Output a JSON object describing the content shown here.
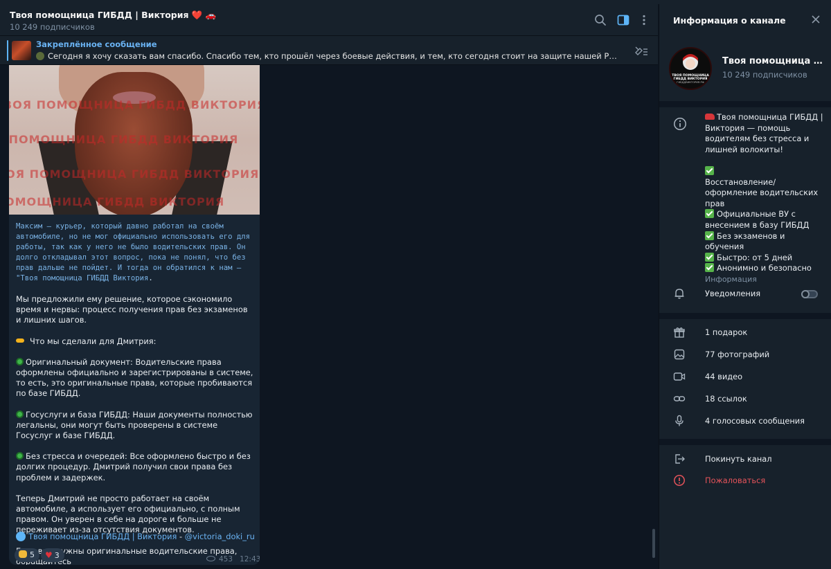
{
  "chat": {
    "title": "Твоя помощница ГИБДД | Виктория ❤️ 🚗",
    "subscribers": "10 249 подписчиков"
  },
  "pinned": {
    "label": "Закреплённое сообщение",
    "text": "Сегодня я хочу сказать вам спасибо. Спасибо тем, кто прошёл через боевые действия, и тем, кто сегодня стоит на защите нашей Родины.  Я — просто Викт..."
  },
  "message": {
    "watermark": "ТВОЯ ПОМОЩНИЦА ГИБДД ВИКТОРИЯ",
    "mono_text": "Максим – курьер, который давно работал на своём автомобиле, но не мог официально использовать его для работы, так как у него не было водительских прав. Он долго откладывал этот вопрос, пока не понял, что без прав дальше не пойдет. И тогда он обратился к нам – \"Твоя помощница ГИБДД Виктория",
    "mono_end": ".",
    "p1": "Мы предложили ему решение, которое сэкономило время и нервы: процесс получения прав без экзаменов и лишних шагов.",
    "p2": "Что мы сделали для Дмитрия:",
    "p3": "Оригинальный документ: Водительские права оформлены официально и зарегистрированы в системе, то есть, это оригинальные права, которые пробиваются по базе ГИБДД.",
    "p4": "Госуслуги и база ГИБДД: Наши документы полностью легальны, они могут быть проверены в системе Госуслуг и базе ГИБДД.",
    "p5": "Без стресса и очередей: Все оформлено быстро и без долгих процедур. Дмитрий получил свои права без проблем и задержек.",
    "p6": "Теперь Дмитрий не просто работает на своём автомобиле, а использует его официально, с полным правом. Он уверен в себе на дороге и больше не переживает из-за отсутствия документов.",
    "p7": "Если вам нужны оригинальные водительские права, обращайтесь",
    "signature_name": "Твоя помощница ГИБДД | Виктория",
    "signature_sep": " - ",
    "signature_handle": "@victoria_doki_ru",
    "reaction_clap": "5",
    "reaction_heart": "3",
    "views": "453",
    "time": "12:43"
  },
  "side": {
    "title": "Информация о канале",
    "channel_name": "Твоя помощница ГИБДД | Виктория",
    "subscribers": "10 249 подписчиков",
    "avatar_text1": "ТВОЯ ПОМОЩНИЦА",
    "avatar_text2": "ГИБДД ВИКТОРИЯ",
    "avatar_text3": "ГИБДДВИКТОРИЯ.РФ",
    "desc_intro": "Твоя помощница ГИБДД | Виктория — помощь водителям без стресса и лишней волокиты!",
    "desc_items": [
      "Восстановление/оформление водительских прав",
      "Официальные ВУ с внесением в базу ГИБДД",
      "Без экзаменов и обучения",
      "Быстро: от 5 дней",
      "Анонимно и безопасно"
    ],
    "desc_label": "Информация",
    "notifications": "Уведомления",
    "media": {
      "gifts": "1 подарок",
      "photos": "77 фотографий",
      "videos": "44 видео",
      "links": "18 ссылок",
      "voice": "4 голосовых сообщения"
    },
    "leave": "Покинуть канал",
    "report": "Пожаловаться"
  },
  "colors": {
    "accent": "#6ab3f3",
    "danger": "#e5535a",
    "background": "#0e1621",
    "panel": "#17212b",
    "bubble": "#182533"
  }
}
